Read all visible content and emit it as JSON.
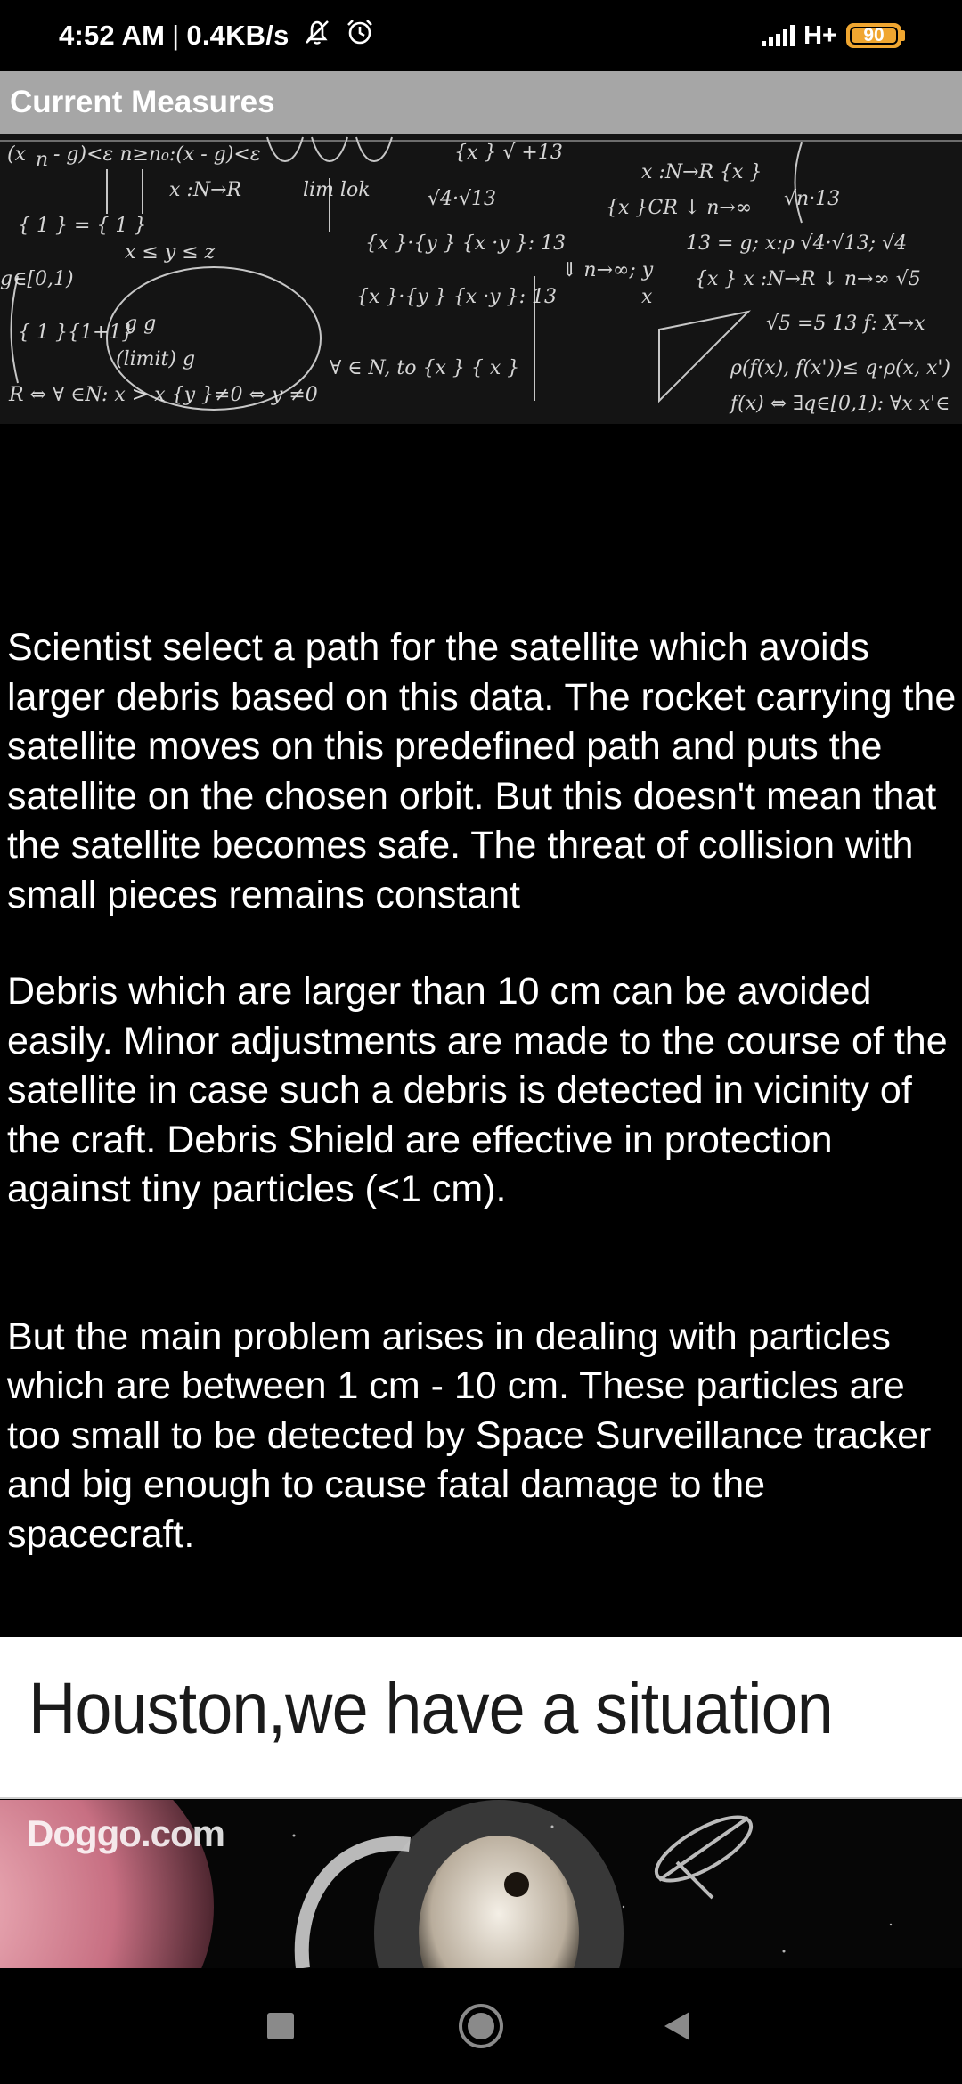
{
  "status_bar": {
    "time": "4:52 AM",
    "separator": "|",
    "net_speed": "0.4KB/s",
    "network_type": "H+",
    "battery_level": "90",
    "icons": [
      "mute-bell-icon",
      "alarm-icon",
      "signal-icon",
      "battery-icon"
    ],
    "battery_color": "#f0a630"
  },
  "app_bar": {
    "title": "Current Measures",
    "background": "#a6a6a6"
  },
  "banner": {
    "icon": "math-formulas-image"
  },
  "content": {
    "paragraphs": [
      "Scientist select a path for the satellite which avoids larger debris based on this data. The rocket carrying the satellite moves on this predefined path and puts the satellite on the chosen orbit. But this doesn't mean that the satellite becomes safe. The threat of collision with small pieces remains constant",
      "Debris which are larger than 10 cm can be avoided easily. Minor adjustments are made to the course of the satellite in case such a debris is detected in vicinity of the craft. Debris Shield are effective in protection against tiny particles (<1 cm).",
      "But the main problem arises in dealing with particles which are between 1 cm - 10 cm. These particles are too small to be detected by Space Surveillance tracker and big enough to cause fatal damage to the spacecraft."
    ]
  },
  "meme": {
    "caption": "Houston,we have a situation",
    "watermark": "Doggo.com"
  },
  "nav_bar": {
    "buttons": [
      "recents-square-icon",
      "home-circle-icon",
      "back-triangle-icon"
    ]
  }
}
